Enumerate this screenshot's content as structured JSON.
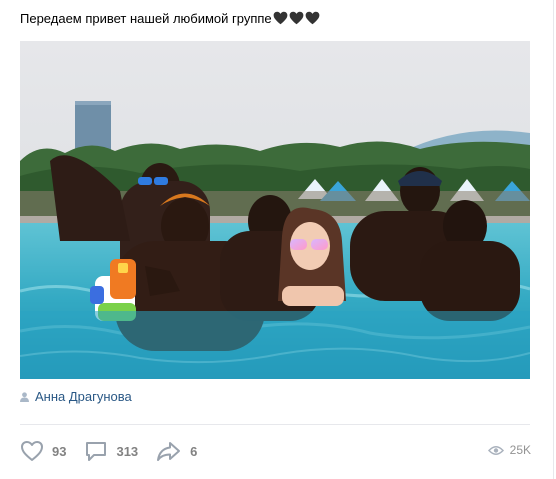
{
  "post": {
    "text": "Передаем привет нашей любимой группе",
    "emoji": "🖤🖤🖤",
    "author": "Анна Драгунова"
  },
  "actions": {
    "likes": "93",
    "comments": "313",
    "shares": "6",
    "views": "25K"
  },
  "icons": {
    "like": "heart-icon",
    "comment": "comment-icon",
    "share": "share-icon",
    "views": "eye-icon",
    "author": "person-icon"
  },
  "colors": {
    "link": "#2a5885",
    "muted": "#828282",
    "divider": "#e7e8ec"
  }
}
